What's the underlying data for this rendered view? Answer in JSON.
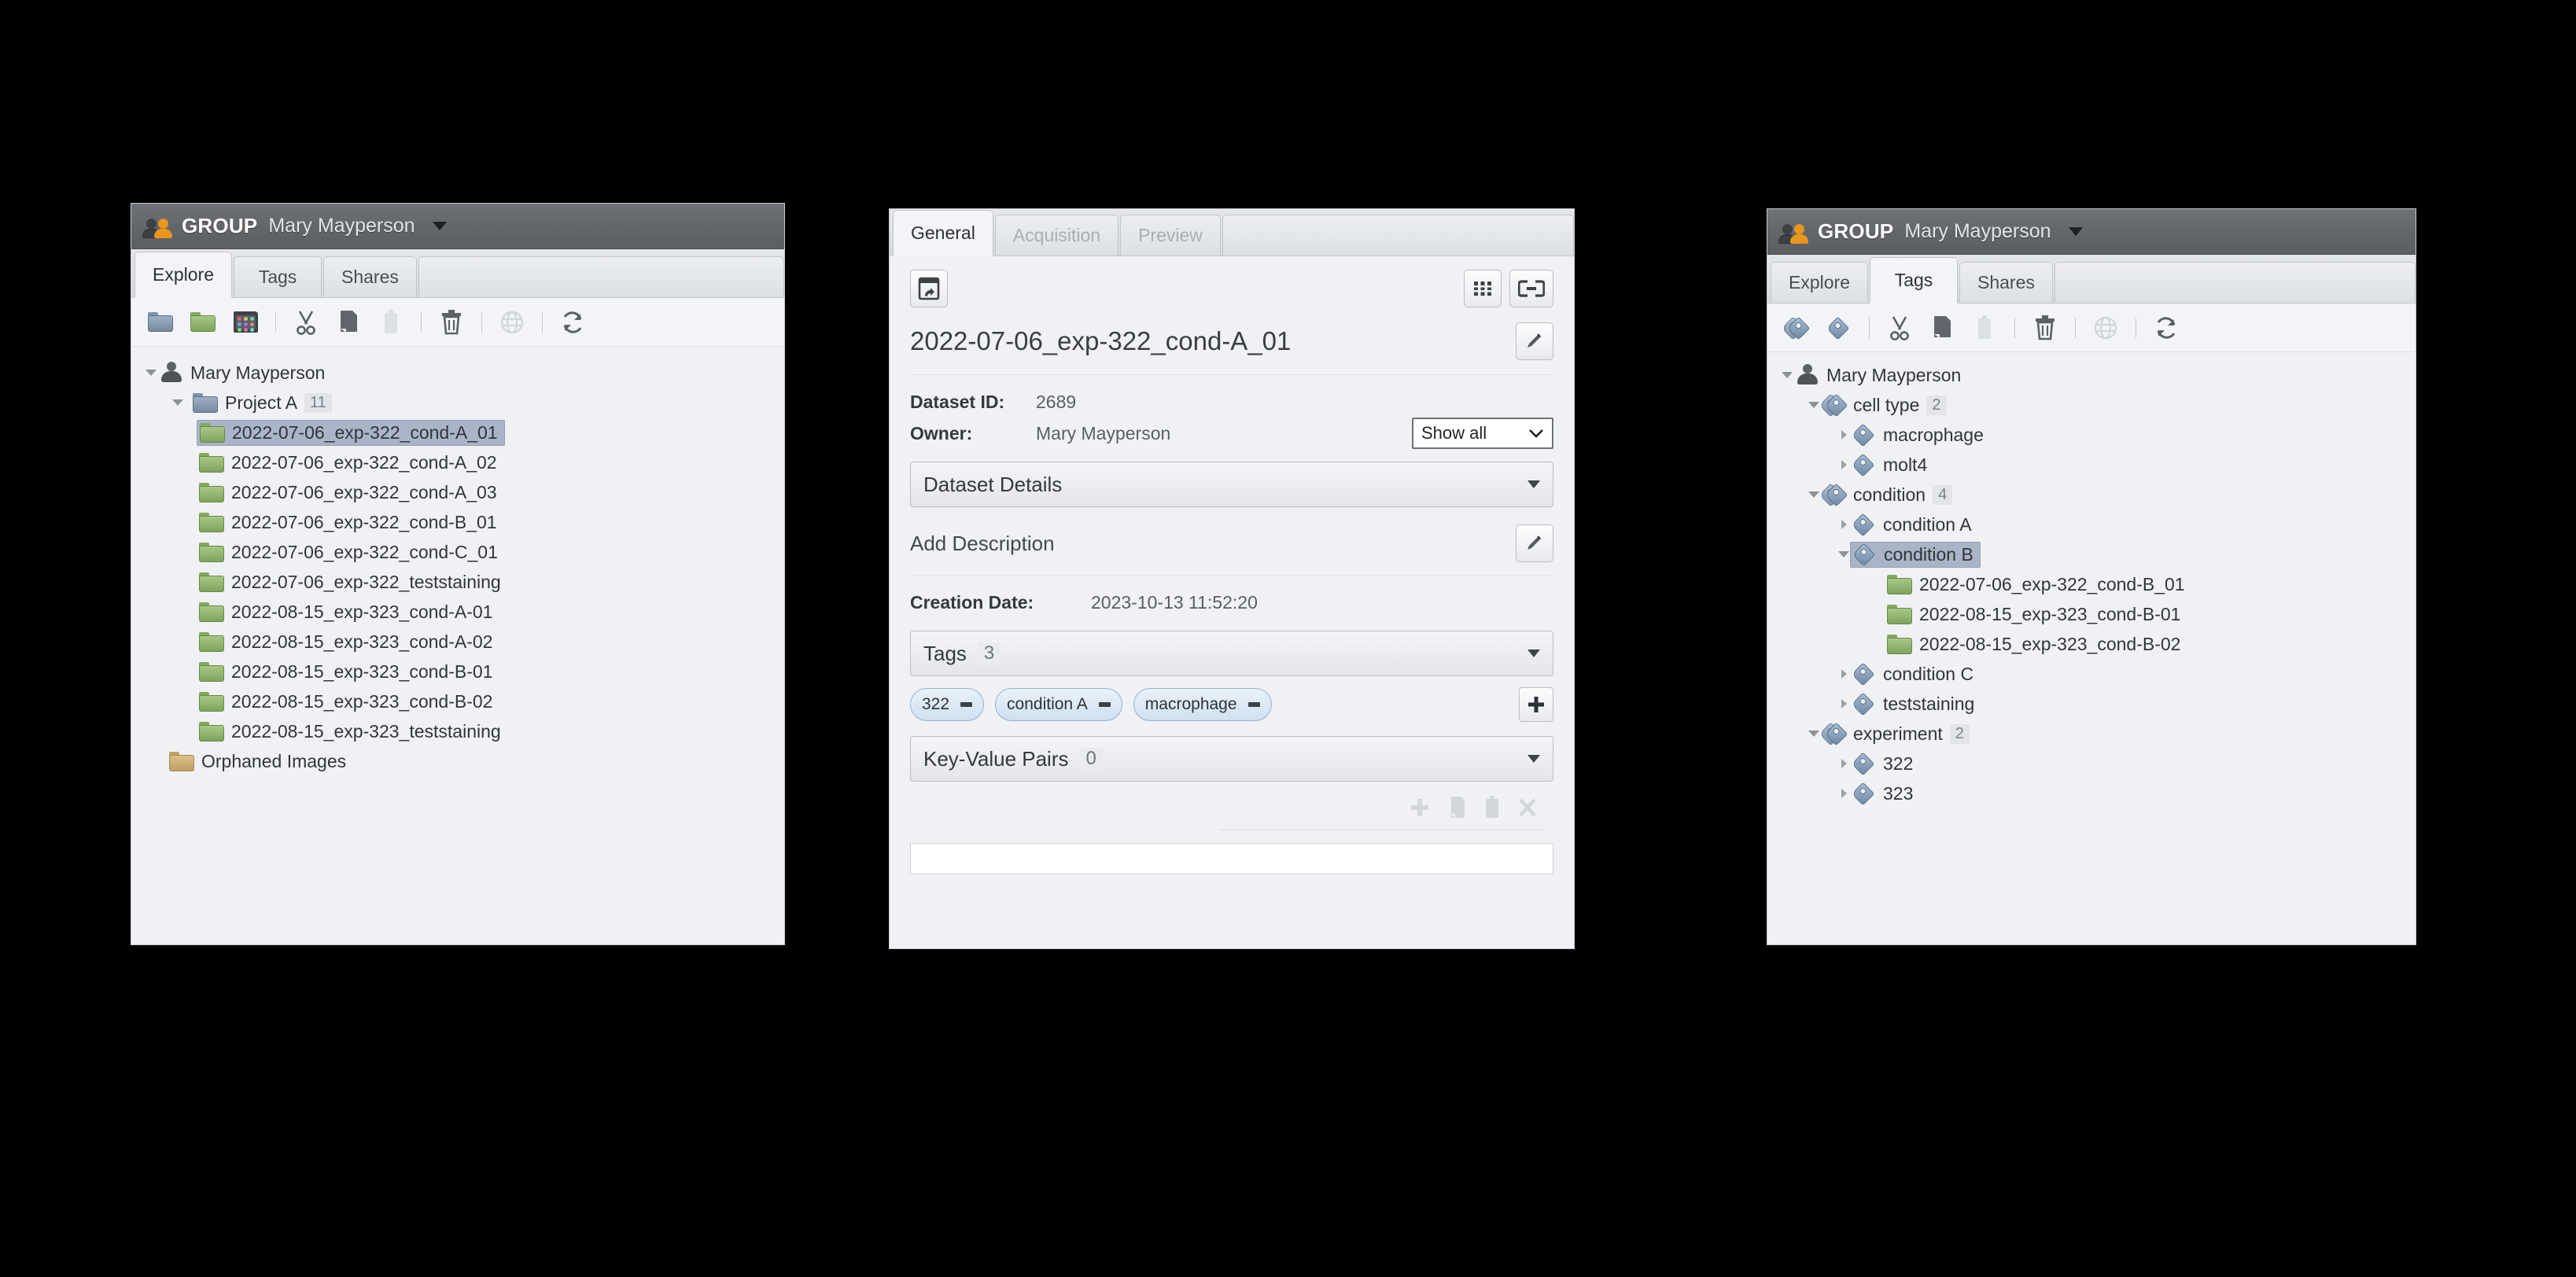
{
  "app": {
    "group_label": "GROUP",
    "user_name": "Mary Mayperson"
  },
  "left_panel": {
    "tabs": [
      {
        "label": "Explore",
        "active": true
      },
      {
        "label": "Tags",
        "active": false
      },
      {
        "label": "Shares",
        "active": false
      }
    ],
    "toolbar": [
      {
        "name": "new-project-icon",
        "title": "New Project"
      },
      {
        "name": "new-dataset-icon",
        "title": "New Dataset"
      },
      {
        "name": "new-screen-icon",
        "title": "New Screen"
      },
      {
        "name": "cut-icon",
        "title": "Cut"
      },
      {
        "name": "copy-icon",
        "title": "Copy"
      },
      {
        "name": "paste-icon",
        "title": "Paste"
      },
      {
        "name": "delete-icon",
        "title": "Delete"
      },
      {
        "name": "publish-icon",
        "title": "Publish"
      },
      {
        "name": "refresh-icon",
        "title": "Refresh"
      }
    ],
    "tree": {
      "root": "Mary Mayperson",
      "project": {
        "label": "Project A",
        "count": "11"
      },
      "datasets": [
        "2022-07-06_exp-322_cond-A_01",
        "2022-07-06_exp-322_cond-A_02",
        "2022-07-06_exp-322_cond-A_03",
        "2022-07-06_exp-322_cond-B_01",
        "2022-07-06_exp-322_cond-C_01",
        "2022-07-06_exp-322_teststaining",
        "2022-08-15_exp-323_cond-A-01",
        "2022-08-15_exp-323_cond-A-02",
        "2022-08-15_exp-323_cond-B-01",
        "2022-08-15_exp-323_cond-B-02",
        "2022-08-15_exp-323_teststaining"
      ],
      "selected_dataset": "2022-07-06_exp-322_cond-A_01",
      "orphaned": "Orphaned Images"
    }
  },
  "middle_panel": {
    "tabs": [
      {
        "label": "General",
        "active": true,
        "disabled": false
      },
      {
        "label": "Acquisition",
        "active": false,
        "disabled": true
      },
      {
        "label": "Preview",
        "active": false,
        "disabled": true
      }
    ],
    "open_in_viewer_title": "Open in viewer",
    "thumbnail_grid_title": "Thumbnails",
    "link_title": "Link",
    "dataset_title": "2022-07-06_exp-322_cond-A_01",
    "edit_name_title": "Edit name",
    "fields": [
      {
        "key": "Dataset ID:",
        "value": "2689"
      },
      {
        "key": "Owner:",
        "value": "Mary Mayperson"
      }
    ],
    "show_filter": {
      "selected": "Show all",
      "options": [
        "Show all"
      ]
    },
    "dataset_details_label": "Dataset Details",
    "add_description_label": "Add Description",
    "edit_description_title": "Edit description",
    "creation_date": {
      "key": "Creation Date:",
      "value": "2023-10-13 11:52:20"
    },
    "tags_section": {
      "label": "Tags",
      "count": "3"
    },
    "tag_chips": [
      "322",
      "condition A",
      "macrophage"
    ],
    "add_tag_title": "Add tag",
    "kvp_section": {
      "label": "Key-Value Pairs",
      "count": "0"
    },
    "kvp_toolbar": [
      {
        "name": "add-icon",
        "glyph": "+"
      },
      {
        "name": "copy-icon",
        "glyph": "❐"
      },
      {
        "name": "paste-icon",
        "glyph": "▮"
      },
      {
        "name": "remove-icon",
        "glyph": "✕"
      }
    ]
  },
  "right_panel": {
    "tabs": [
      {
        "label": "Explore",
        "active": false
      },
      {
        "label": "Tags",
        "active": true
      },
      {
        "label": "Shares",
        "active": false
      }
    ],
    "toolbar": [
      {
        "name": "new-tagset-icon",
        "title": "New Tag Set"
      },
      {
        "name": "new-tag-icon",
        "title": "New Tag"
      },
      {
        "name": "cut-icon",
        "title": "Cut"
      },
      {
        "name": "copy-icon",
        "title": "Copy"
      },
      {
        "name": "paste-icon",
        "title": "Paste"
      },
      {
        "name": "delete-icon",
        "title": "Delete"
      },
      {
        "name": "publish-icon",
        "title": "Publish"
      },
      {
        "name": "refresh-icon",
        "title": "Refresh"
      }
    ],
    "tree": {
      "root": "Mary Mayperson",
      "groups": [
        {
          "label": "cell type",
          "count": "2",
          "expanded": true,
          "children": [
            {
              "label": "macrophage",
              "expanded": false,
              "selected": false,
              "datasets": []
            },
            {
              "label": "molt4",
              "expanded": false,
              "selected": false,
              "datasets": []
            }
          ]
        },
        {
          "label": "condition",
          "count": "4",
          "expanded": true,
          "children": [
            {
              "label": "condition A",
              "expanded": false,
              "selected": false,
              "datasets": []
            },
            {
              "label": "condition B",
              "expanded": true,
              "selected": true,
              "datasets": [
                "2022-07-06_exp-322_cond-B_01",
                "2022-08-15_exp-323_cond-B-01",
                "2022-08-15_exp-323_cond-B-02"
              ]
            },
            {
              "label": "condition C",
              "expanded": false,
              "selected": false,
              "datasets": []
            },
            {
              "label": "teststaining",
              "expanded": false,
              "selected": false,
              "datasets": []
            }
          ]
        },
        {
          "label": "experiment",
          "count": "2",
          "expanded": true,
          "children": [
            {
              "label": "322",
              "expanded": false,
              "selected": false,
              "datasets": []
            },
            {
              "label": "323",
              "expanded": false,
              "selected": false,
              "datasets": []
            }
          ]
        }
      ]
    }
  },
  "colors": {
    "titlebar": "#63666b",
    "panel_bg": "#f0f1f4",
    "selection": "#a9b5c6",
    "tag_blue": "#8fb3d4",
    "folder_green": "#8fb363",
    "folder_blue": "#8599b0",
    "folder_tan": "#c9a969"
  }
}
